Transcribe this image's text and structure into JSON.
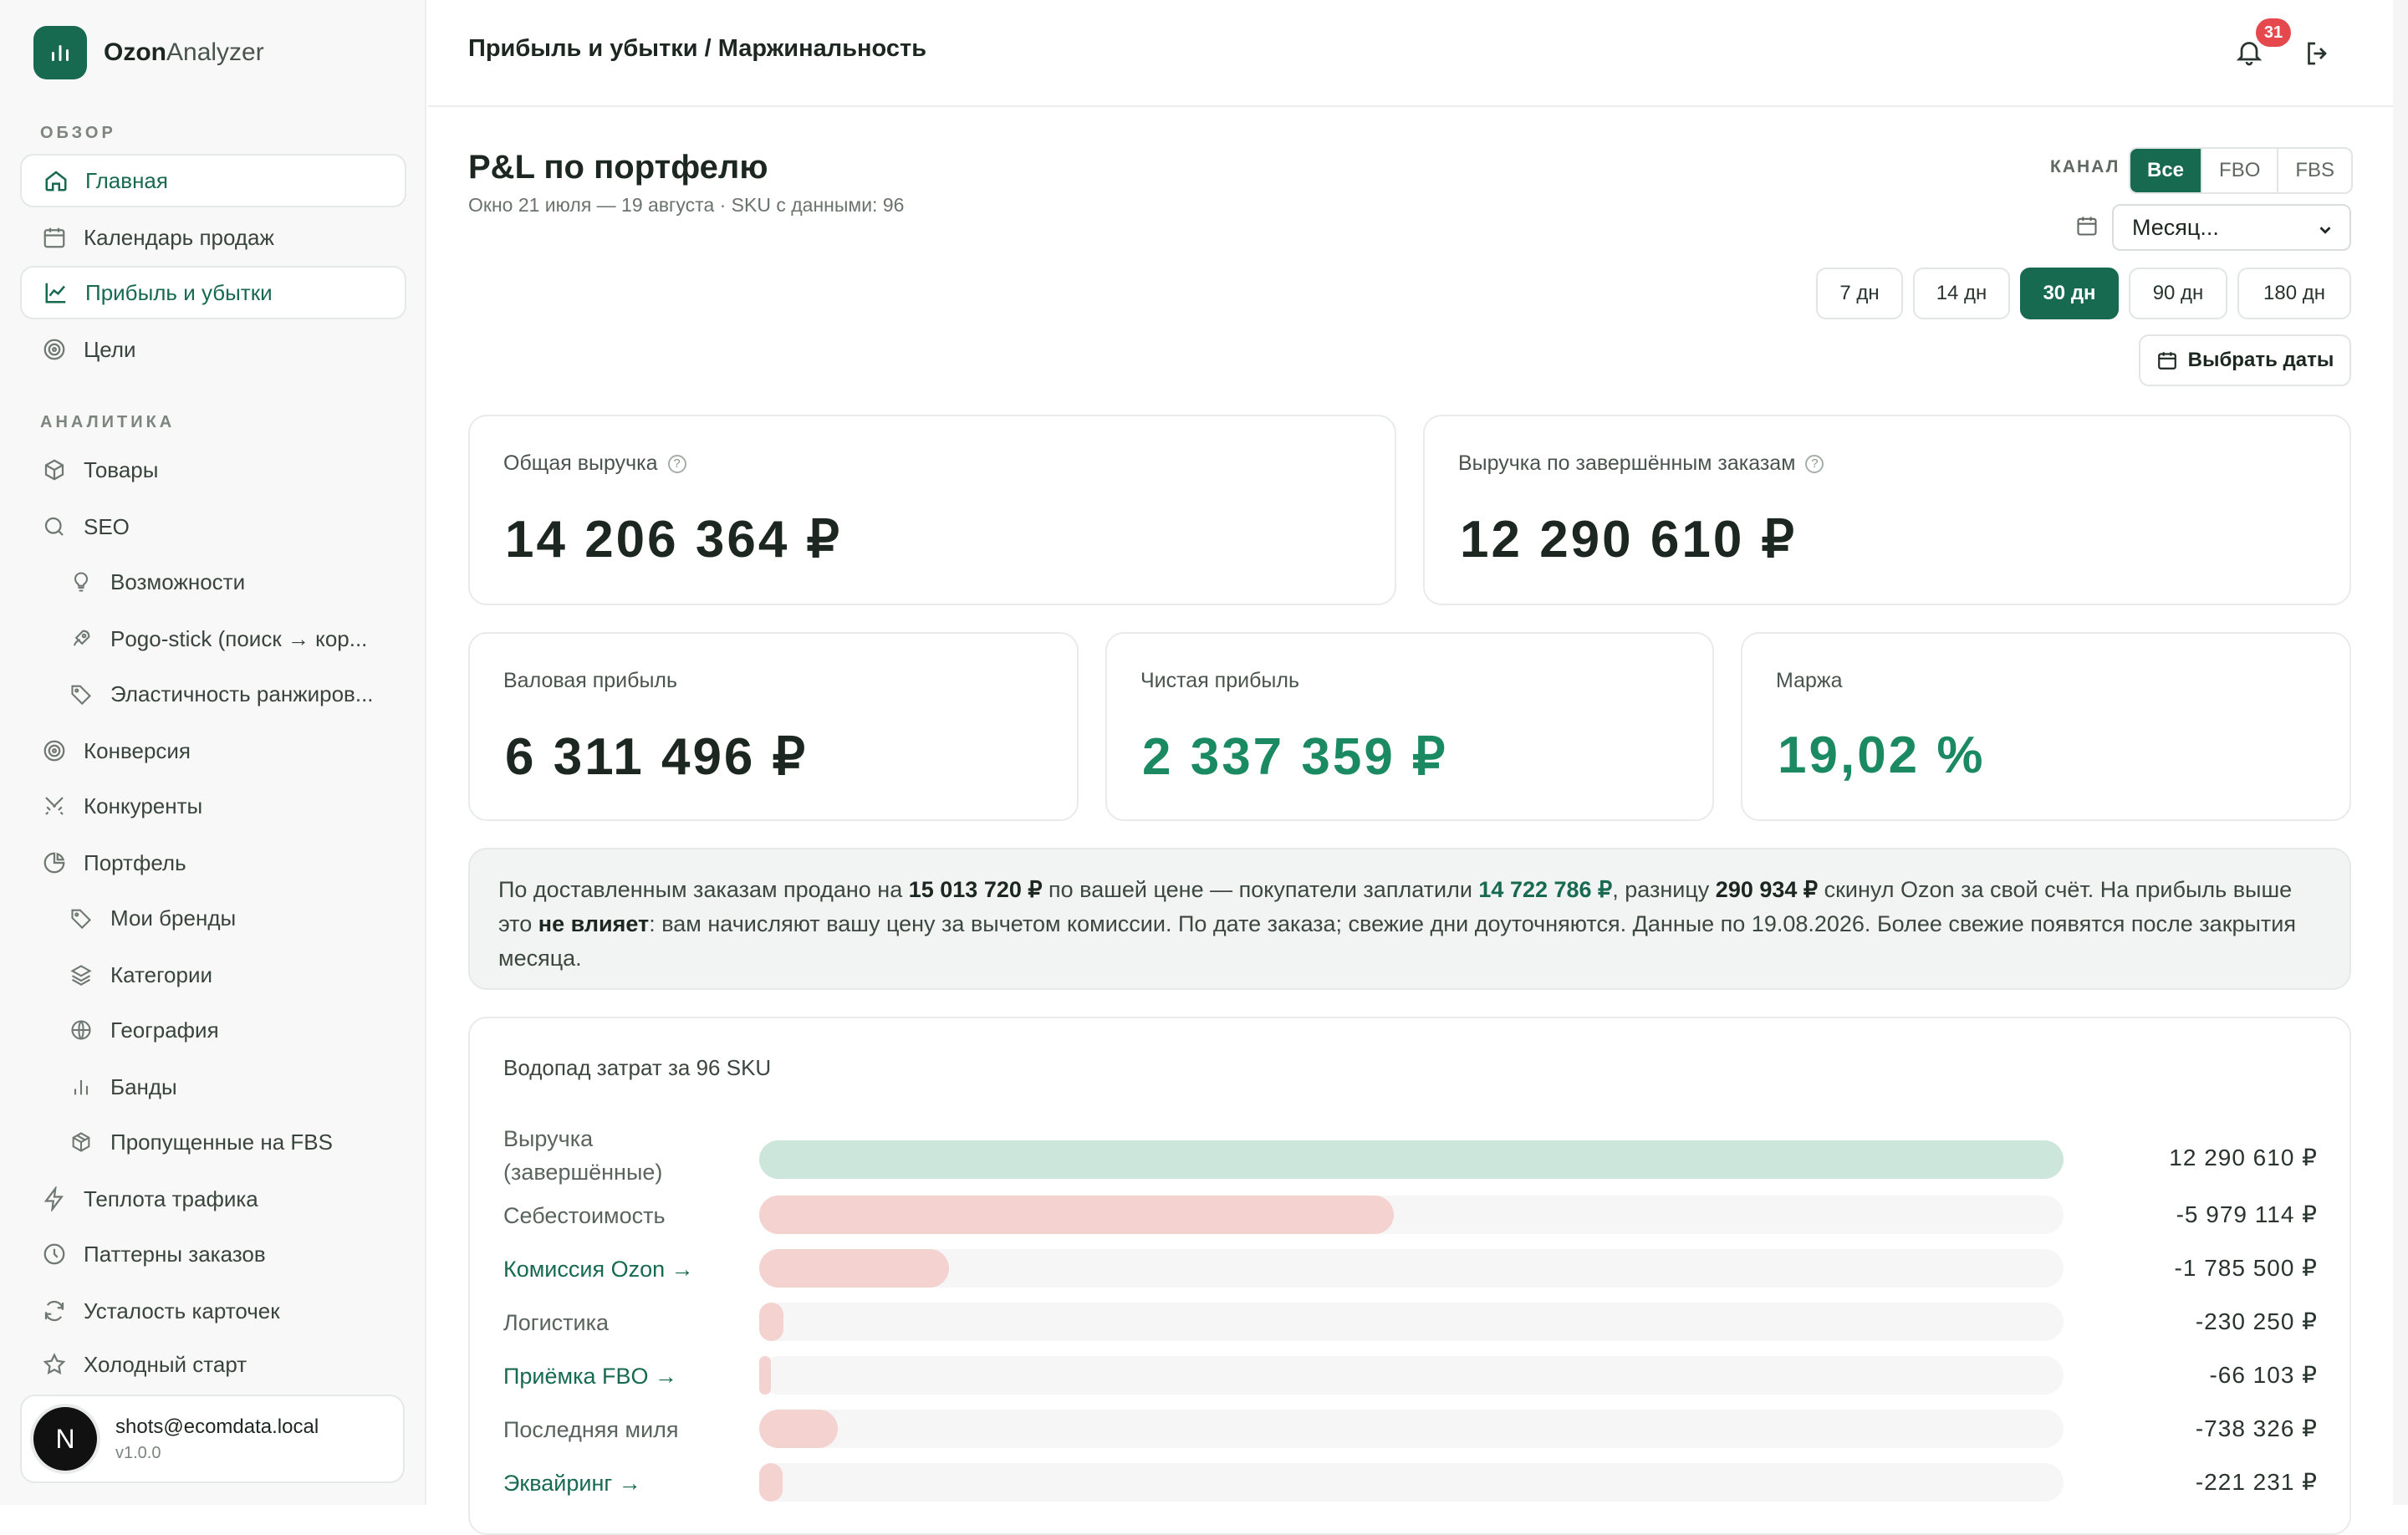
{
  "app": {
    "name_bold": "Ozon",
    "name_light": "Analyzer"
  },
  "sidebar": {
    "section_overview": "ОБЗОР",
    "section_analytics": "АНАЛИТИКА",
    "items": [
      {
        "label": "Главная",
        "icon": "home-icon"
      },
      {
        "label": "Календарь продаж",
        "icon": "calendar-icon"
      },
      {
        "label": "Прибыль и убытки",
        "icon": "chart-line-icon"
      },
      {
        "label": "Цели",
        "icon": "target-icon"
      },
      {
        "label": "Товары",
        "icon": "box-icon"
      },
      {
        "label": "SEO",
        "icon": "search-icon"
      },
      {
        "label": "Возможности",
        "icon": "lightbulb-icon"
      },
      {
        "label": "Pogo-stick (поиск → кор...",
        "icon": "rocket-icon"
      },
      {
        "label": "Эластичность ранжиров...",
        "icon": "tag-icon"
      },
      {
        "label": "Конверсия",
        "icon": "target-icon"
      },
      {
        "label": "Конкуренты",
        "icon": "swords-icon"
      },
      {
        "label": "Портфель",
        "icon": "pie-chart-icon"
      },
      {
        "label": "Мои бренды",
        "icon": "tag-icon"
      },
      {
        "label": "Категории",
        "icon": "layers-icon"
      },
      {
        "label": "География",
        "icon": "globe-icon"
      },
      {
        "label": "Банды",
        "icon": "bars-icon"
      },
      {
        "label": "Пропущенные на FBS",
        "icon": "boxes-icon"
      },
      {
        "label": "Теплота трафика",
        "icon": "bolt-icon"
      },
      {
        "label": "Паттерны заказов",
        "icon": "clock-icon"
      },
      {
        "label": "Усталость карточек",
        "icon": "refresh-icon"
      },
      {
        "label": "Холодный старт",
        "icon": "star-icon"
      }
    ],
    "user": {
      "initial": "N",
      "email": "shots@ecomdata.local",
      "version": "v1.0.0"
    }
  },
  "header": {
    "breadcrumb": "Прибыль и убытки / Маржинальность",
    "notifications_count": "31"
  },
  "page": {
    "title": "P&L по портфелю",
    "subtitle": "Окно 21 июля — 19 августа · SKU с данными: 96"
  },
  "controls": {
    "channel_label": "КАНАЛ",
    "channels": [
      "Все",
      "FBO",
      "FBS"
    ],
    "channel_selected": "Все",
    "granularity_value": "Месяц...",
    "periods": [
      "7 дн",
      "14 дн",
      "30 дн",
      "90 дн",
      "180 дн"
    ],
    "period_selected": "30 дн",
    "pick_dates_label": "Выбрать даты"
  },
  "kpis": {
    "total_revenue": {
      "label": "Общая выручка",
      "value": "14 206 364 ₽"
    },
    "completed_revenue": {
      "label": "Выручка по завершённым заказам",
      "value": "12 290 610 ₽"
    },
    "gross_profit": {
      "label": "Валовая прибыль",
      "value": "6 311 496 ₽"
    },
    "net_profit": {
      "label": "Чистая прибыль",
      "value": "2 337 359 ₽"
    },
    "margin": {
      "label": "Маржа",
      "value": "19,02 %"
    }
  },
  "note": {
    "p1": "По доставленным заказам продано на ",
    "v1": "15 013 720 ₽",
    "p2": " по вашей цене — покупатели заплатили ",
    "v2": "14 722 786 ₽",
    "p3": ", разницу ",
    "v3": "290 934 ₽",
    "p4": " скинул Ozon за свой счёт. На прибыль выше это ",
    "v4": "не влияет",
    "p5": ": вам начисляют вашу цену за вычетом комиссии. По дате заказа; свежие дни доуточняются. Данные по 19.08.2026. Более свежие появятся после закрытия месяца."
  },
  "waterfall": {
    "title": "Водопад затрат за 96 SKU",
    "colors": {
      "positive": "#cde6dc",
      "negative": "#f3d2d0",
      "track": "#f5f6f5"
    },
    "rows": [
      {
        "label": "Выручка (завершённые)",
        "value": "12 290 610 ₽",
        "amount": 12290610,
        "link": false
      },
      {
        "label": "Себестоимость",
        "value": "-5 979 114 ₽",
        "amount": -5979114,
        "link": false
      },
      {
        "label": "Комиссия Ozon →",
        "value": "-1 785 500 ₽",
        "amount": -1785500,
        "link": true
      },
      {
        "label": "Логистика",
        "value": "-230 250 ₽",
        "amount": -230250,
        "link": false
      },
      {
        "label": "Приёмка FBO →",
        "value": "-66 103 ₽",
        "amount": -66103,
        "link": true
      },
      {
        "label": "Последняя миля",
        "value": "-738 326 ₽",
        "amount": -738326,
        "link": false
      },
      {
        "label": "Эквайринг →",
        "value": "-221 231 ₽",
        "amount": -221231,
        "link": true
      }
    ]
  }
}
